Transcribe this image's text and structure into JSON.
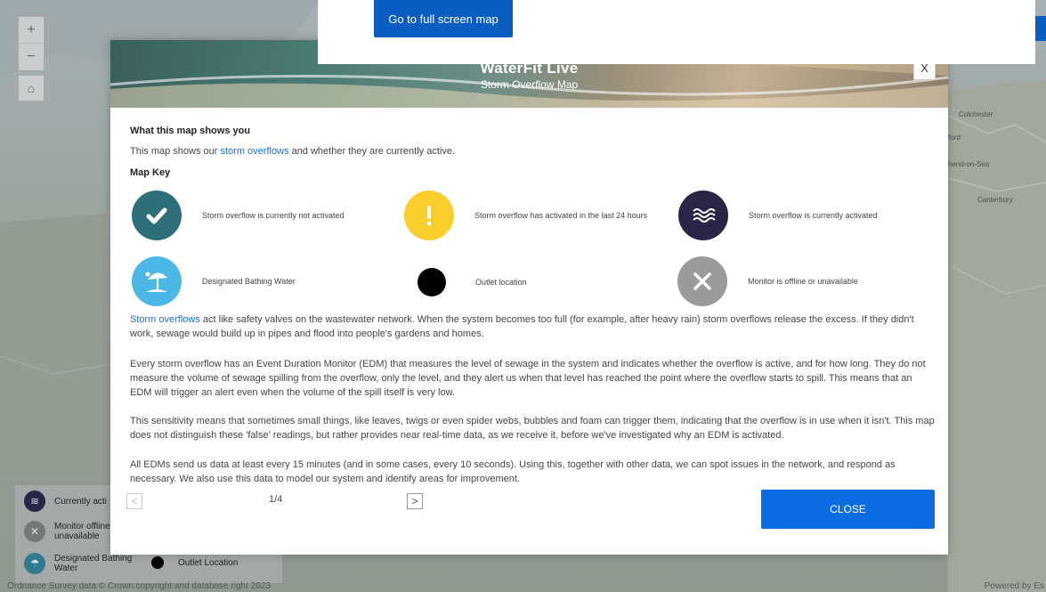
{
  "top_panel": {
    "full_screen_button": "Go to full screen map"
  },
  "map": {
    "zoom_in": "+",
    "zoom_out": "−",
    "towns": [
      "Colchester",
      "ford",
      "hend-on-Sea",
      "Canterbury"
    ],
    "copyright": "Ordnance Survey data © Crown copyright and database right 2023",
    "powered_by": "Powered by Es",
    "legend": {
      "currently_active": "Currently acti",
      "monitor_offline_1": "Monitor offline",
      "monitor_offline_2": "unavailable",
      "bathing_1": "Designated Bathing",
      "bathing_2": "Water",
      "outlet": "Outlet Location"
    }
  },
  "modal": {
    "title": "WaterFit Live",
    "subtitle": "Storm Overflow Map",
    "close_x": "X",
    "what_heading": "What this map shows you",
    "intro_prefix": "This map shows our ",
    "intro_link": "storm overflows",
    "intro_suffix": " and whether they are currently active.",
    "key_heading": "Map Key",
    "key": [
      {
        "label": "Storm overflow is currently not activated",
        "icon": "check-icon",
        "color": "#2f6f7a"
      },
      {
        "label": "Storm overflow has activated in the last 24 hours",
        "icon": "exclamation-icon",
        "color": "#f8cf2c"
      },
      {
        "label": "Storm overflow is currently activated",
        "icon": "waves-icon",
        "color": "#2a2447"
      },
      {
        "label": "Designated Bathing Water",
        "icon": "beach-umbrella-icon",
        "color": "#4bb8e6"
      },
      {
        "label": "Outlet location",
        "icon": "outlet-dot-icon",
        "color": "#000000"
      },
      {
        "label": "Monitor is offline or unavailable",
        "icon": "x-icon",
        "color": "#9b9b9b"
      }
    ],
    "p1_link": "Storm overflows",
    "p1_text": " act like safety valves on the wastewater network. When the system becomes too full (for example, after heavy rain) storm overflows release the excess. If they didn't work, sewage would build up in pipes and flood into people's gardens and homes.",
    "p2": "Every storm overflow has an Event Duration Monitor (EDM) that measures the level of sewage in the system and indicates whether the overflow is active, and for how long. They do not measure the volume of sewage spilling from the overflow, only the level, and they alert us when that level has reached the point where the overflow starts to spill. This means that an EDM will trigger an alert even when the volume of the spill itself is very low.",
    "p3": "This sensitivity means that sometimes small things, like leaves, twigs or even spider webs, bubbles and foam can trigger them, indicating that the overflow is in use when it isn't. This map does not distinguish these 'false' readings, but rather provides near real-time data, as we receive it, before we've investigated why an EDM is activated.",
    "p4": "All EDMs send us data at least every 15 minutes (and in some cases, every 10 seconds). Using this, together with other data, we can spot issues in the network, and respond as necessary. We also use this data to model our system and identify areas for improvement.",
    "prev": "<",
    "next": ">",
    "page": "1/4",
    "close_button": "CLOSE"
  }
}
